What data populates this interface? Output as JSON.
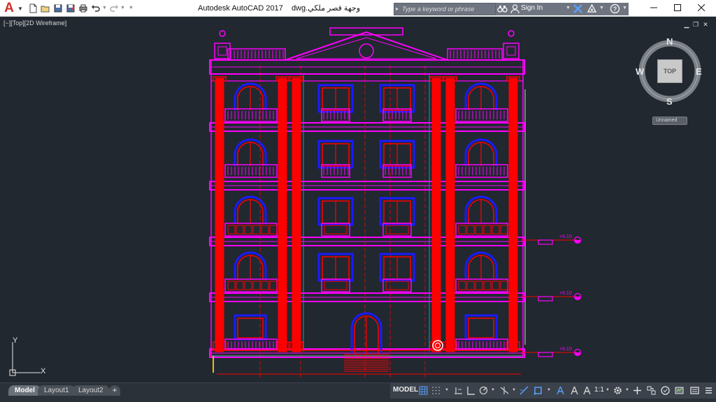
{
  "titlebar": {
    "app_name": "Autodesk AutoCAD 2017",
    "file_name": "وجهة قصر ملكي.dwg",
    "search_placeholder": "Type a keyword or phrase",
    "sign_in": "Sign In"
  },
  "viewport": {
    "label": "[−][Top][2D Wireframe]",
    "viewcube": {
      "north": "N",
      "south": "S",
      "east": "E",
      "west": "W",
      "face": "TOP",
      "wcs": "Unnamed"
    },
    "ucs": {
      "x": "X",
      "y": "Y"
    },
    "level_markers": [
      "+5.10",
      "+5.10",
      "+5.10"
    ]
  },
  "tabs": {
    "model": "Model",
    "layout1": "Layout1",
    "layout2": "Layout2",
    "add": "+"
  },
  "status": {
    "model": "MODEL",
    "scale": "1:1"
  },
  "colors": {
    "viewport_bg": "#212830",
    "magenta": "#ff00ff",
    "red": "#ff0000",
    "blue": "#1a1aff",
    "cyan": "#00c8c8",
    "white": "#ffffff"
  }
}
